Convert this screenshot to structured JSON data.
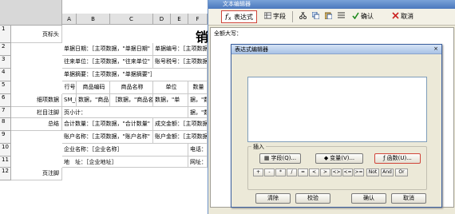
{
  "sheet": {
    "columns": [
      "A",
      "B",
      "C",
      "D",
      "E",
      "F"
    ],
    "rows": [
      "1",
      "2",
      "3",
      "4",
      "5",
      "6",
      "7",
      "8",
      "9",
      "10",
      "11",
      "12"
    ],
    "labels": {
      "r1": "页标头",
      "r6": "细项数据",
      "r7": "栏目注脚",
      "r8": "总结",
      "r12": "页注脚"
    },
    "big_title": "销",
    "cells": {
      "r2a": "单据日期：［主项数据，\"单据日期\"",
      "r2b": "单据编号：［主项数据，",
      "r3a": "往来单位：［主项数据，\"往来单位\"",
      "r3b": "账号税号：［主项数据，",
      "r4a": "单据摘要：［主项数据，\"单据摘要\"］",
      "r5_no": "行号",
      "r5_code": "商品编码",
      "r5_name": "商品名称",
      "r5_unit": "单位",
      "r5_qty": "数量",
      "r6_no": "SM_Lin",
      "r6_code": "数据，\"商品",
      "r6_name": "［数据，\"商品名称",
      "r6_unit": "数据，\"单",
      "r6_qty": "据，\"数量\"",
      "r7_left": "页小计：",
      "r7_qty": "据，\"数量\"",
      "r8a": "合计数量：［主项数据，\"合计数量\"",
      "r8b": "成交金额：［主项数据，",
      "r9a": "账户名称：［主项数据，\"账户名称\"",
      "r9b": "账户金额：［主项数据，",
      "r10a": "企业名称：［企业名称］",
      "r10b": "电话：［联",
      "r11a": "地　址：［企业地址］",
      "r11b": "网址：［网"
    }
  },
  "editor": {
    "title": "文本编辑器",
    "toolbar": {
      "expression": "表达式",
      "field": "字段",
      "confirm": "确认",
      "cancel": "取消"
    },
    "content_label": "全额大写："
  },
  "dialog": {
    "title": "表达式编辑器",
    "close": "×",
    "insert_label": "插入",
    "field_btn": "字段(Q)...",
    "variable_btn": "变量(V)...",
    "function_btn": "函数(U)...",
    "operators": [
      "+",
      "-",
      "*",
      "/",
      "=",
      "<",
      ">",
      "<>",
      "<=",
      ">=",
      "Not",
      "And",
      "Or"
    ],
    "clear": "清除",
    "validate": "校验",
    "ok": "确认",
    "cancel": "取消"
  }
}
